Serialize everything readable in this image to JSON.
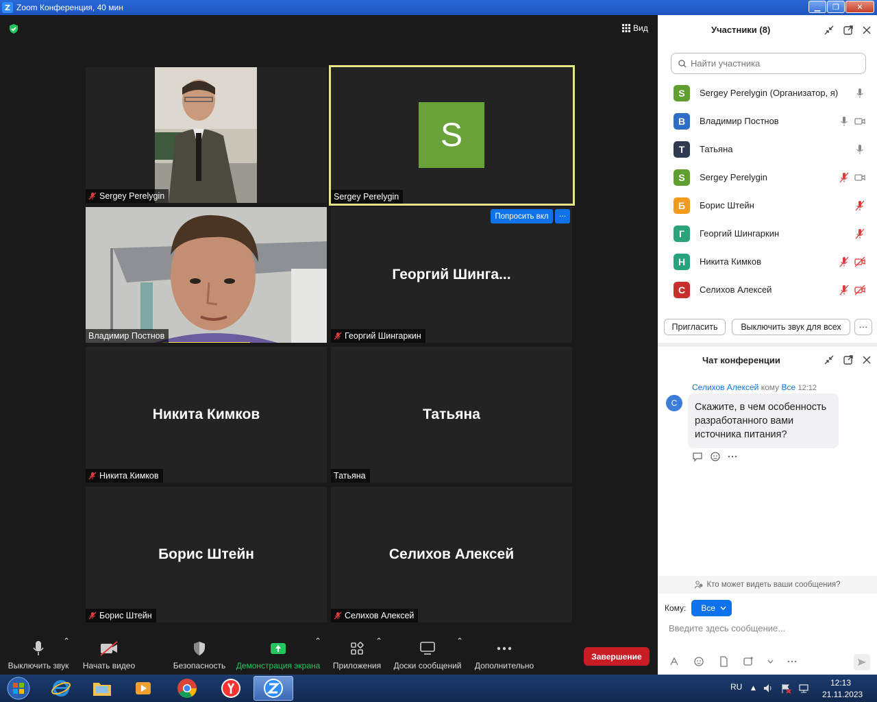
{
  "window": {
    "title": "Zoom Конференция, 40 мин",
    "minimize": "▁",
    "maximize": "❐",
    "close": "✕"
  },
  "topbar": {
    "view_label": "Вид"
  },
  "tiles": [
    {
      "name": "Sergey Perelygin",
      "big": "",
      "mic_muted": true,
      "video": true
    },
    {
      "name": "Sergey Perelygin",
      "big": "",
      "avatar_letter": "S",
      "active_speaker": true,
      "mic_muted": false
    },
    {
      "name": "Владимир Постнов",
      "big": "",
      "mic_muted": false,
      "video": true
    },
    {
      "name": "Георгий Шингаркин",
      "big": "Георгий  Шинга...",
      "mic_muted": true
    },
    {
      "name": "Никита Кимков",
      "big": "Никита Кимков",
      "mic_muted": true
    },
    {
      "name": "Татьяна",
      "big": "Татьяна",
      "mic_muted": false
    },
    {
      "name": "Борис Штейн",
      "big": "Борис Штейн",
      "mic_muted": true
    },
    {
      "name": "Селихов Алексей",
      "big": "Селихов Алексей",
      "mic_muted": true
    }
  ],
  "tile_actions": {
    "ask_unmute": "Попросить вкл",
    "more": "···"
  },
  "toolbar": {
    "mute": "Выключить звук",
    "video": "Начать видео",
    "security": "Безопасность",
    "share": "Демонстрация экрана",
    "apps": "Приложения",
    "whiteboards": "Доски сообщений",
    "more": "Дополнительно",
    "end": "Завершение"
  },
  "participants_panel": {
    "title": "Участники (8)",
    "search_placeholder": "Найти участника",
    "items": [
      {
        "letter": "S",
        "name": "Sergey Perelygin (Организатор, я)",
        "color": "#5f9e2f",
        "mic": "on",
        "cam": "none"
      },
      {
        "letter": "В",
        "name": "Владимир Постнов",
        "color": "#2d6fc4",
        "mic": "on",
        "cam": "on"
      },
      {
        "letter": "Т",
        "name": "Татьяна",
        "color": "#2e3a4f",
        "mic": "on",
        "cam": "none"
      },
      {
        "letter": "S",
        "name": "Sergey Perelygin",
        "color": "#5f9e2f",
        "mic": "off",
        "cam": "on"
      },
      {
        "letter": "Б",
        "name": "Борис Штейн",
        "color": "#f29a1e",
        "mic": "off",
        "cam": "none"
      },
      {
        "letter": "Г",
        "name": "Георгий Шингаркин",
        "color": "#2aa37a",
        "mic": "off",
        "cam": "none"
      },
      {
        "letter": "Н",
        "name": "Никита Кимков",
        "color": "#27a37e",
        "mic": "off",
        "cam": "off"
      },
      {
        "letter": "С",
        "name": "Селихов Алексей",
        "color": "#c9302c",
        "mic": "off",
        "cam": "off"
      }
    ],
    "invite": "Пригласить",
    "mute_all": "Выключить звук для всех",
    "more": "···"
  },
  "chat_panel": {
    "title": "Чат конференции",
    "message": {
      "sender": "Селихов Алексей",
      "to_word": "кому",
      "recipient": "Все",
      "time": "12:12",
      "avatar_letter": "С",
      "text": "Скажите, в чем особенность разработанного вами источника питания?"
    },
    "visibility_note": "Кто может видеть ваши сообщения?",
    "to_label": "Кому:",
    "to_value": "Все",
    "input_placeholder": "Введите здесь сообщение..."
  },
  "taskbar": {
    "lang": "RU",
    "time": "12:13",
    "date": "21.11.2023"
  },
  "colors": {
    "accent": "#2d8cff",
    "end": "#c81d25",
    "share_green": "#23c55e",
    "active_border": "#e5e58a",
    "muted_red": "#e03a3a"
  }
}
